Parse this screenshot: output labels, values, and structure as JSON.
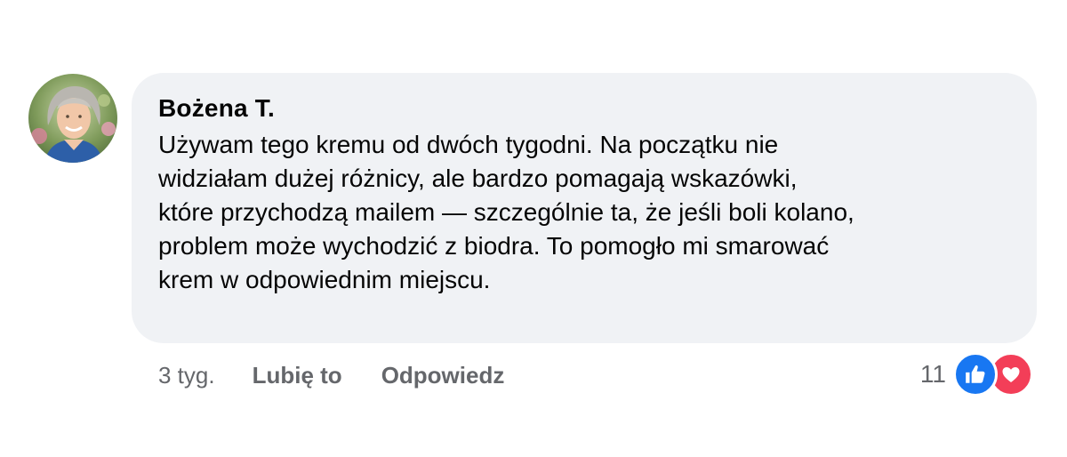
{
  "comment": {
    "author": "Bożena T.",
    "text_lines": [
      "Używam tego kremu od dwóch tygodni. Na początku nie",
      "widziałam dużej różnicy, ale bardzo pomagają wskazówki,",
      "które przychodzą mailem — szczególnie ta, że jeśli boli kolano,",
      "problem może wychodzić z biodra. To pomogło mi smarować",
      "krem w odpowiednim miejscu."
    ],
    "avatar_icon": "user-photo-avatar"
  },
  "actions": {
    "timestamp": "3 tyg.",
    "like_label": "Lubię to",
    "reply_label": "Odpowiedz"
  },
  "reactions": {
    "count": "11",
    "icons": [
      "like-icon",
      "love-icon"
    ],
    "colors": {
      "like": "#1877f2",
      "love": "#f33e58"
    }
  },
  "colors": {
    "bubble_bg": "#f0f2f5",
    "meta_text": "#65676b",
    "text": "#050505"
  }
}
